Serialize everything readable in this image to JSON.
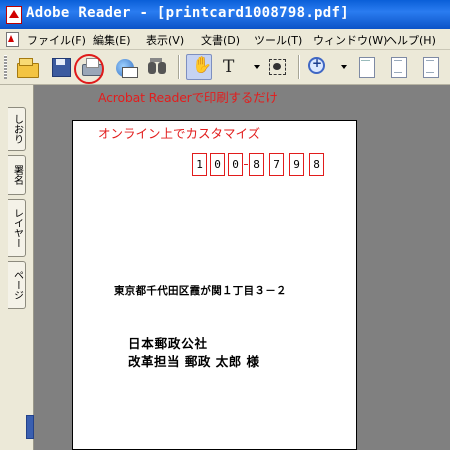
{
  "window": {
    "title": "Adobe Reader - [printcard1008798.pdf]"
  },
  "menu": {
    "items": [
      {
        "label": "ファイル(F)"
      },
      {
        "label": "編集(E)"
      },
      {
        "label": "表示(V)"
      },
      {
        "label": "文書(D)"
      },
      {
        "label": "ツール(T)"
      },
      {
        "label": "ウィンドウ(W)"
      },
      {
        "label": "ヘルプ(H)"
      }
    ]
  },
  "toolbar": {
    "buttons": [
      {
        "icon": "open-folder-icon"
      },
      {
        "icon": "save-icon"
      },
      {
        "icon": "printer-icon"
      },
      {
        "icon": "email-icon"
      },
      {
        "icon": "search-binoculars-icon"
      },
      {
        "icon": "hand-tool-icon",
        "glyph": "✋"
      },
      {
        "icon": "select-text-icon",
        "glyph": "T"
      },
      {
        "icon": "snapshot-icon"
      },
      {
        "icon": "zoom-in-icon"
      },
      {
        "icon": "single-page-icon"
      },
      {
        "icon": "continuous-page-icon"
      },
      {
        "icon": "facing-pages-icon"
      }
    ]
  },
  "annotations": {
    "print_note": "Acrobat Readerで印刷するだけ",
    "customize_note": "オンライン上でカスタマイズ",
    "color": "#e21d1d"
  },
  "nav_pane": {
    "tabs": [
      {
        "label": "しおり"
      },
      {
        "label": "署名"
      },
      {
        "label": "レイヤー"
      },
      {
        "label": "ページ"
      }
    ]
  },
  "postcard": {
    "postal_code_digits": [
      "1",
      "0",
      "0",
      "8",
      "7",
      "9",
      "8"
    ],
    "address": "東京都千代田区霞が関１丁目３－２",
    "addressee_company": "日本郵政公社",
    "addressee_person": "改革担当 郵政 太郎 様"
  }
}
